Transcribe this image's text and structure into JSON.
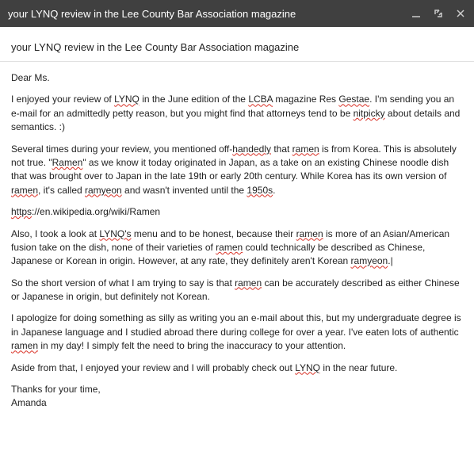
{
  "window": {
    "title": "your LYNQ review in the Lee County Bar Association magazine"
  },
  "email": {
    "subject": "your LYNQ review in the Lee County Bar Association magazine",
    "greeting": "Dear Ms.",
    "p1_a": "I enjoyed your review of ",
    "p1_lynq": "LYNQ",
    "p1_b": " in the June edition of the ",
    "p1_lcba": "LCBA",
    "p1_c": " magazine Res ",
    "p1_gestae": "Gestae",
    "p1_d": ". I'm sending you an e-mail for an admittedly petty reason, but you might find that attorneys tend to be ",
    "p1_nitpicky": "nitpicky",
    "p1_e": " about details and semantics. :)",
    "p2_a": "Several times during your review, you mentioned off-",
    "p2_handedly": "handedly",
    "p2_b": " that ",
    "p2_ramen1": "ramen",
    "p2_c": " is from Korea. This is absolutely not true. \"",
    "p2_ramen2": "Ramen",
    "p2_d": "\" as we know it today originated in Japan, as a take on an existing Chinese noodle dish that was brought over to Japan in the late 19th or early 20th century. While Korea has its own version of ",
    "p2_ramen3": "ramen",
    "p2_e": ", it's called ",
    "p2_ramyeon": "ramyeon",
    "p2_f": " and wasn't invented until the ",
    "p2_1950s": "1950s",
    "p2_g": ".",
    "link_a": "https",
    "link_b": "://en.wikipedia.org/wiki/Ramen",
    "p3_a": "Also, I took a look at ",
    "p3_lynqs": "LYNQ's",
    "p3_b": " menu and to be honest, because their ",
    "p3_ramen1": "ramen",
    "p3_c": " is more of an Asian/American fusion take on the dish, none of their varieties of ",
    "p3_ramen2": "ramen",
    "p3_d": " could technically be described as Chinese, Japanese or Korean in origin. However, at any rate, they definitely aren't Korean ",
    "p3_ramyeon": "ramyeon",
    "p3_e": ".",
    "p4_a": "So the short version of what I am trying to say is that ",
    "p4_ramen": "ramen",
    "p4_b": " can be accurately described as either Chinese or Japanese in origin, but definitely not Korean.",
    "p5_a": "I apologize for doing something as silly as writing you an e-mail about this, but my undergraduate degree is in Japanese language and I studied abroad there during college for over a year. I've eaten lots of authentic ",
    "p5_ramen": "ramen",
    "p5_b": " in my day! I simply felt the need to bring the inaccuracy to your attention.",
    "p6_a": "Aside from that, I enjoyed your review and I will probably check out ",
    "p6_lynq": "LYNQ",
    "p6_b": " in the near future.",
    "closing_a": "Thanks for your time,",
    "closing_b": "Amanda"
  }
}
